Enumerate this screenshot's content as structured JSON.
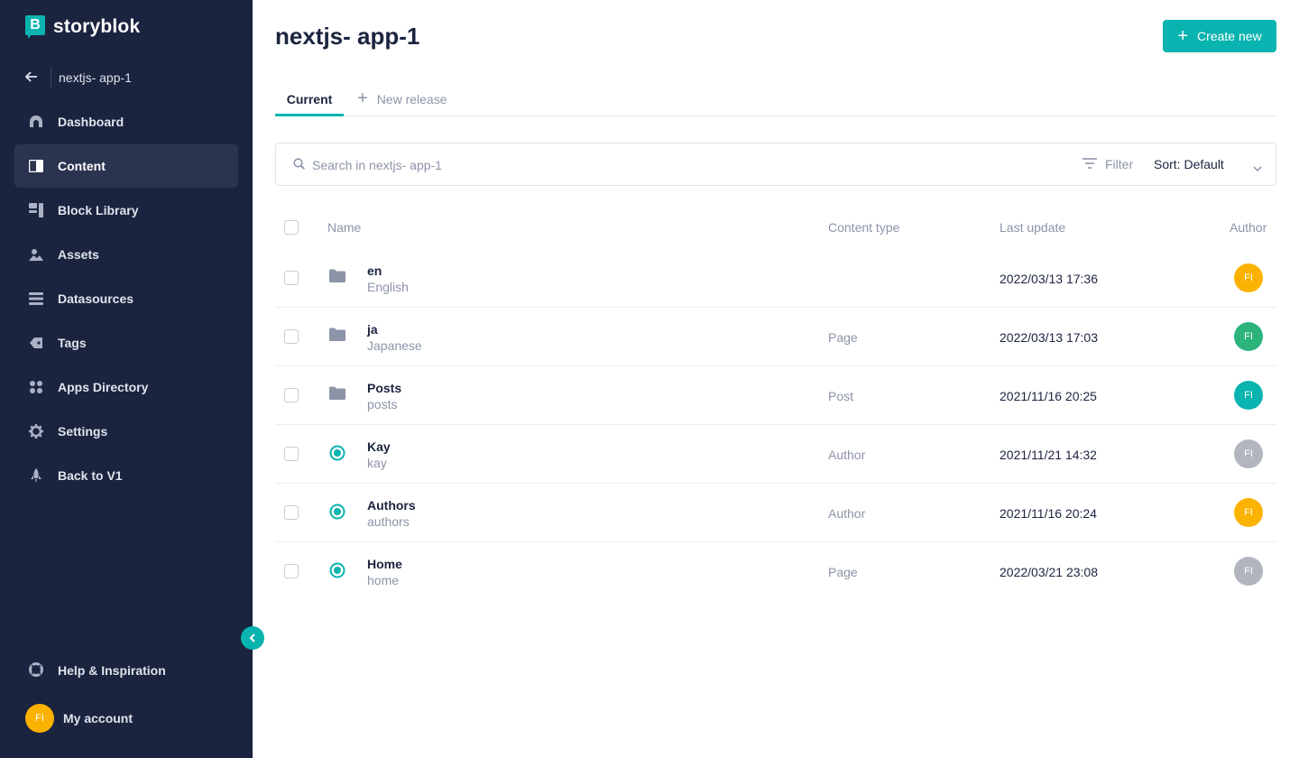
{
  "brand": {
    "name": "storyblok",
    "logo_letter": "B"
  },
  "sidebar": {
    "space_name": "nextjs- app-1",
    "items": [
      {
        "label": "Dashboard",
        "icon": "dashboard-icon",
        "active": false
      },
      {
        "label": "Content",
        "icon": "content-icon",
        "active": true
      },
      {
        "label": "Block Library",
        "icon": "block-library-icon",
        "active": false
      },
      {
        "label": "Assets",
        "icon": "assets-icon",
        "active": false
      },
      {
        "label": "Datasources",
        "icon": "datasources-icon",
        "active": false
      },
      {
        "label": "Tags",
        "icon": "tags-icon",
        "active": false
      },
      {
        "label": "Apps Directory",
        "icon": "apps-icon",
        "active": false
      },
      {
        "label": "Settings",
        "icon": "gear-icon",
        "active": false
      },
      {
        "label": "Back to V1",
        "icon": "rocket-icon",
        "active": false
      }
    ],
    "help_label": "Help & Inspiration",
    "account_label": "My account",
    "account_initials": "FI"
  },
  "header": {
    "title": "nextjs- app-1",
    "create_label": "Create new"
  },
  "tabs": {
    "current": "Current",
    "new_release": "New release"
  },
  "search": {
    "placeholder": "Search in nextjs- app-1",
    "filter_label": "Filter",
    "sort_label": "Sort: Default"
  },
  "table": {
    "headers": {
      "name": "Name",
      "content_type": "Content type",
      "last_update": "Last update",
      "author": "Author"
    },
    "rows": [
      {
        "name": "en",
        "slug": "English",
        "content_type": "",
        "last_update": "2022/03/13 17:36",
        "author": "FI",
        "author_color": "#fbb200",
        "kind": "folder"
      },
      {
        "name": "ja",
        "slug": "Japanese",
        "content_type": "Page",
        "last_update": "2022/03/13 17:03",
        "author": "FI",
        "author_color": "#2db47d",
        "kind": "folder"
      },
      {
        "name": "Posts",
        "slug": "posts",
        "content_type": "Post",
        "last_update": "2021/11/16 20:25",
        "author": "FI",
        "author_color": "#09b3af",
        "kind": "folder"
      },
      {
        "name": "Kay",
        "slug": "kay",
        "content_type": "Author",
        "last_update": "2021/11/21 14:32",
        "author": "FI",
        "author_color": "#b1b5be",
        "kind": "story"
      },
      {
        "name": "Authors",
        "slug": "authors",
        "content_type": "Author",
        "last_update": "2021/11/16 20:24",
        "author": "FI",
        "author_color": "#fbb200",
        "kind": "story"
      },
      {
        "name": "Home",
        "slug": "home",
        "content_type": "Page",
        "last_update": "2022/03/21 23:08",
        "author": "FI",
        "author_color": "#b1b5be",
        "kind": "story"
      }
    ]
  },
  "colors": {
    "sidebar_bg": "#1b243f",
    "accent": "#09b3af",
    "muted": "#8d94a8"
  }
}
